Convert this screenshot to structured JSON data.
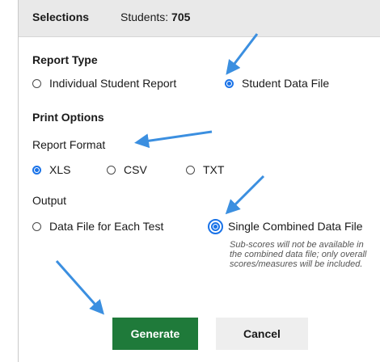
{
  "header": {
    "title": "Selections",
    "students_label": "Students:",
    "students_count": "705"
  },
  "report_type": {
    "heading": "Report Type",
    "options": [
      {
        "label": "Individual Student Report",
        "selected": false
      },
      {
        "label": "Student Data File",
        "selected": true
      }
    ]
  },
  "print_options": {
    "heading": "Print Options"
  },
  "report_format": {
    "label": "Report Format",
    "options": [
      {
        "label": "XLS",
        "selected": true
      },
      {
        "label": "CSV",
        "selected": false
      },
      {
        "label": "TXT",
        "selected": false
      }
    ]
  },
  "output": {
    "label": "Output",
    "options": [
      {
        "label": "Data File for Each Test",
        "selected": false
      },
      {
        "label": "Single Combined Data File",
        "selected": true
      }
    ],
    "note": "Sub-scores will not be available in the combined data file; only overall scores/measures will be included."
  },
  "buttons": {
    "generate": "Generate",
    "cancel": "Cancel"
  },
  "colors": {
    "accent": "#1a73e8",
    "generate_bg": "#1f7a3a",
    "annotation_arrow": "#3b8fe0"
  }
}
